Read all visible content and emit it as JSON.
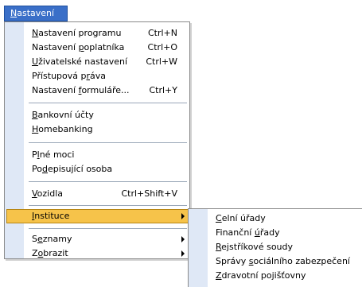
{
  "menubar": {
    "title_mnemonic": "N",
    "title_rest": "astavení"
  },
  "menu": {
    "items": [
      {
        "pre": "",
        "mn": "N",
        "post": "astavení programu",
        "shortcut": "Ctrl+N"
      },
      {
        "pre": "Nastavení ",
        "mn": "p",
        "post": "oplatníka",
        "shortcut": "Ctrl+O"
      },
      {
        "pre": "",
        "mn": "U",
        "post": "živatelské nastavení",
        "shortcut": "Ctrl+W"
      },
      {
        "pre": "Přístupová p",
        "mn": "r",
        "post": "áva",
        "shortcut": ""
      },
      {
        "pre": "Nastavení ",
        "mn": "f",
        "post": "ormuláře...",
        "shortcut": "Ctrl+Y"
      },
      {
        "pre": "",
        "mn": "B",
        "post": "ankovní účty",
        "shortcut": ""
      },
      {
        "pre": "",
        "mn": "H",
        "post": "omebanking",
        "shortcut": ""
      },
      {
        "pre": "P",
        "mn": "l",
        "post": "né moci",
        "shortcut": ""
      },
      {
        "pre": "Po",
        "mn": "d",
        "post": "episující osoba",
        "shortcut": ""
      },
      {
        "pre": "",
        "mn": "V",
        "post": "ozidla",
        "shortcut": "Ctrl+Shift+V"
      },
      {
        "pre": "",
        "mn": "I",
        "post": "nstituce",
        "shortcut": ""
      },
      {
        "pre": "S",
        "mn": "e",
        "post": "znamy",
        "shortcut": ""
      },
      {
        "pre": "Z",
        "mn": "o",
        "post": "brazit",
        "shortcut": ""
      }
    ]
  },
  "submenu": {
    "items": [
      {
        "pre": "",
        "mn": "C",
        "post": "elní úřady"
      },
      {
        "pre": "Finanční ",
        "mn": "ú",
        "post": "řady"
      },
      {
        "pre": "",
        "mn": "R",
        "post": "ejstříkové soudy"
      },
      {
        "pre": "Správy ",
        "mn": "s",
        "post": "ociálního zabezpečení"
      },
      {
        "pre": "",
        "mn": "Z",
        "post": "dravotní pojišťovny"
      }
    ]
  },
  "colors": {
    "highlight": "#f6c34a",
    "menubar_active": "#3a6fc8",
    "gutter": "#dfe8f6"
  }
}
